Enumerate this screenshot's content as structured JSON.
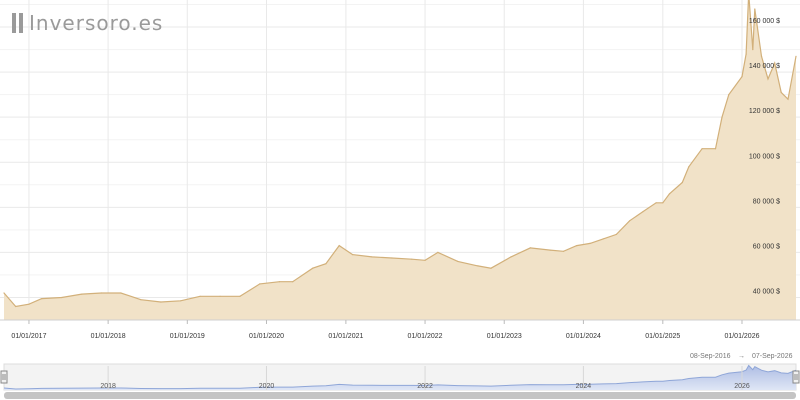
{
  "logo": {
    "text": "Inversoro.es"
  },
  "colors": {
    "area_fill": "#f1e2c8",
    "line": "#d2b07a",
    "grid": "#e9e9e9",
    "nav_fill": "#b9c6e6",
    "nav_line": "#8fa6d8"
  },
  "range": {
    "from": "08-Sep-2016",
    "arrow": "→",
    "to": "07-Sep-2026"
  },
  "navigator": {
    "labels": [
      "2018",
      "2020",
      "2022",
      "2024",
      "2026"
    ]
  },
  "chart_data": {
    "type": "area",
    "title": "",
    "xlabel": "",
    "ylabel": "",
    "grid": true,
    "x_ticks": [
      "01/01/2017",
      "01/01/2018",
      "01/01/2019",
      "01/01/2020",
      "01/01/2021",
      "01/01/2022",
      "01/01/2023",
      "01/01/2024",
      "01/01/2025",
      "01/01/2026"
    ],
    "y_ticks": [
      "40 000 $",
      "60 000 $",
      "80 000 $",
      "100 000 $",
      "120 000 $",
      "140 000 $",
      "160 000 $"
    ],
    "ylim": [
      30000,
      172000
    ],
    "xlim": [
      "2016-09-08",
      "2026-09-07"
    ],
    "series": [
      {
        "x": [
          "2016-09-08",
          "2016-11-01",
          "2017-01-01",
          "2017-03-01",
          "2017-06-01",
          "2017-09-01",
          "2017-12-01",
          "2018-03-01",
          "2018-06-01",
          "2018-09-01",
          "2018-12-01",
          "2019-03-01",
          "2019-06-01",
          "2019-09-01",
          "2019-12-01",
          "2020-03-01",
          "2020-05-01",
          "2020-08-01",
          "2020-10-01",
          "2020-12-01",
          "2021-02-01",
          "2021-05-01",
          "2021-08-01",
          "2021-11-01",
          "2022-01-01",
          "2022-03-01",
          "2022-06-01",
          "2022-09-01",
          "2022-11-01",
          "2023-02-01",
          "2023-05-01",
          "2023-08-01",
          "2023-10-01",
          "2023-12-01",
          "2024-02-01",
          "2024-04-01",
          "2024-06-01",
          "2024-08-01",
          "2024-10-01",
          "2024-12-01",
          "2025-01-01",
          "2025-02-01",
          "2025-04-01",
          "2025-05-01",
          "2025-07-01",
          "2025-09-01",
          "2025-10-01",
          "2025-11-01",
          "2026-01-01",
          "2026-01-20",
          "2026-02-01",
          "2026-02-20",
          "2026-03-01",
          "2026-04-01",
          "2026-05-01",
          "2026-06-01",
          "2026-07-01",
          "2026-08-01",
          "2026-09-07"
        ],
        "y": [
          42000,
          36000,
          37000,
          39500,
          40000,
          41500,
          42000,
          42000,
          39000,
          38000,
          38500,
          40500,
          40500,
          40500,
          46000,
          47000,
          47000,
          53000,
          55000,
          63000,
          59000,
          58000,
          57500,
          57000,
          56500,
          60000,
          56000,
          54000,
          53000,
          58000,
          62000,
          61000,
          60500,
          63000,
          64000,
          66000,
          68000,
          74000,
          78000,
          82000,
          82000,
          86000,
          91000,
          98000,
          106000,
          106000,
          120000,
          130000,
          138000,
          148000,
          175000,
          150000,
          168000,
          147000,
          137000,
          144000,
          131000,
          128000,
          147000
        ]
      }
    ]
  }
}
